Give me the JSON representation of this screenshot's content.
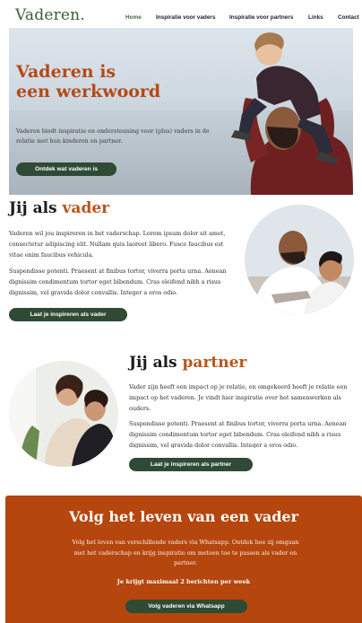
{
  "brand": {
    "logo": "Vaderen."
  },
  "nav": {
    "items": [
      {
        "label": "Home",
        "active": true
      },
      {
        "label": "Inspiratie voor vaders",
        "active": false
      },
      {
        "label": "Inspiratie voor partners",
        "active": false
      },
      {
        "label": "Links",
        "active": false
      },
      {
        "label": "Contact",
        "active": false
      }
    ]
  },
  "hero": {
    "title_line1": "Vaderen is",
    "title_line2": "een werkwoord",
    "text": "Vaderen biedt inspiratie en ondersteuning voor (plus) vaders in de relatie met hun kinderen en partner.",
    "button": "Ontdek wat vaderen is"
  },
  "father_section": {
    "title_prefix": "Jij als ",
    "title_accent": "vader",
    "paragraph1": "Vaderen wil jou inspireren in het vaderschap.  Lorem ipsum dolor sit amet, consectetur adipiscing elit. Nullam quis laoreet libero. Fusce faucibus est vitae enim faucibus vehicula.",
    "paragraph2": "Suspendisse potenti. Praesent at finibus tortor, viverra porta urna. Aenean dignissim condimentum tortor eget bibendum. Cras eleifend nibh a risus dignissim, vel gravida dolor convallis. Integer a eros odio.",
    "button": "Laat je inspireren als vader"
  },
  "partner_section": {
    "title_prefix": "Jij als ",
    "title_accent": "partner",
    "paragraph1": "Vader zijn heeft een impact op je relatie, en omgekeerd heeft je relatie een impact op het vaderen. Je vindt hier inspiratie over het samenwerken als ouders.",
    "paragraph2": "Suspendisse potenti. Praesent at finibus tortor, viverra porta urna. Aenean dignissim condimentum tortor eget bibendum. Cras eleifend nibh a risus dignissim, vel gravida dolor convallis. Integer a eros odio.",
    "button": "Laat je inspireren als partner"
  },
  "cta": {
    "title": "Volg het leven van een vader",
    "text": "Volg het leven van verschillende vaders via Whatsapp. Ontdek hoe zij omgaan met het vaderschap en krijg inspiratie om meteen toe te passen als vader en partner.",
    "note": "Je krijgt maximaal 2 berichten per week",
    "button": "Volg vaderen  via Whatsapp"
  },
  "colors": {
    "accent_orange": "#b9551c",
    "brand_green": "#2f4a35",
    "cta_background": "#b4460e"
  }
}
